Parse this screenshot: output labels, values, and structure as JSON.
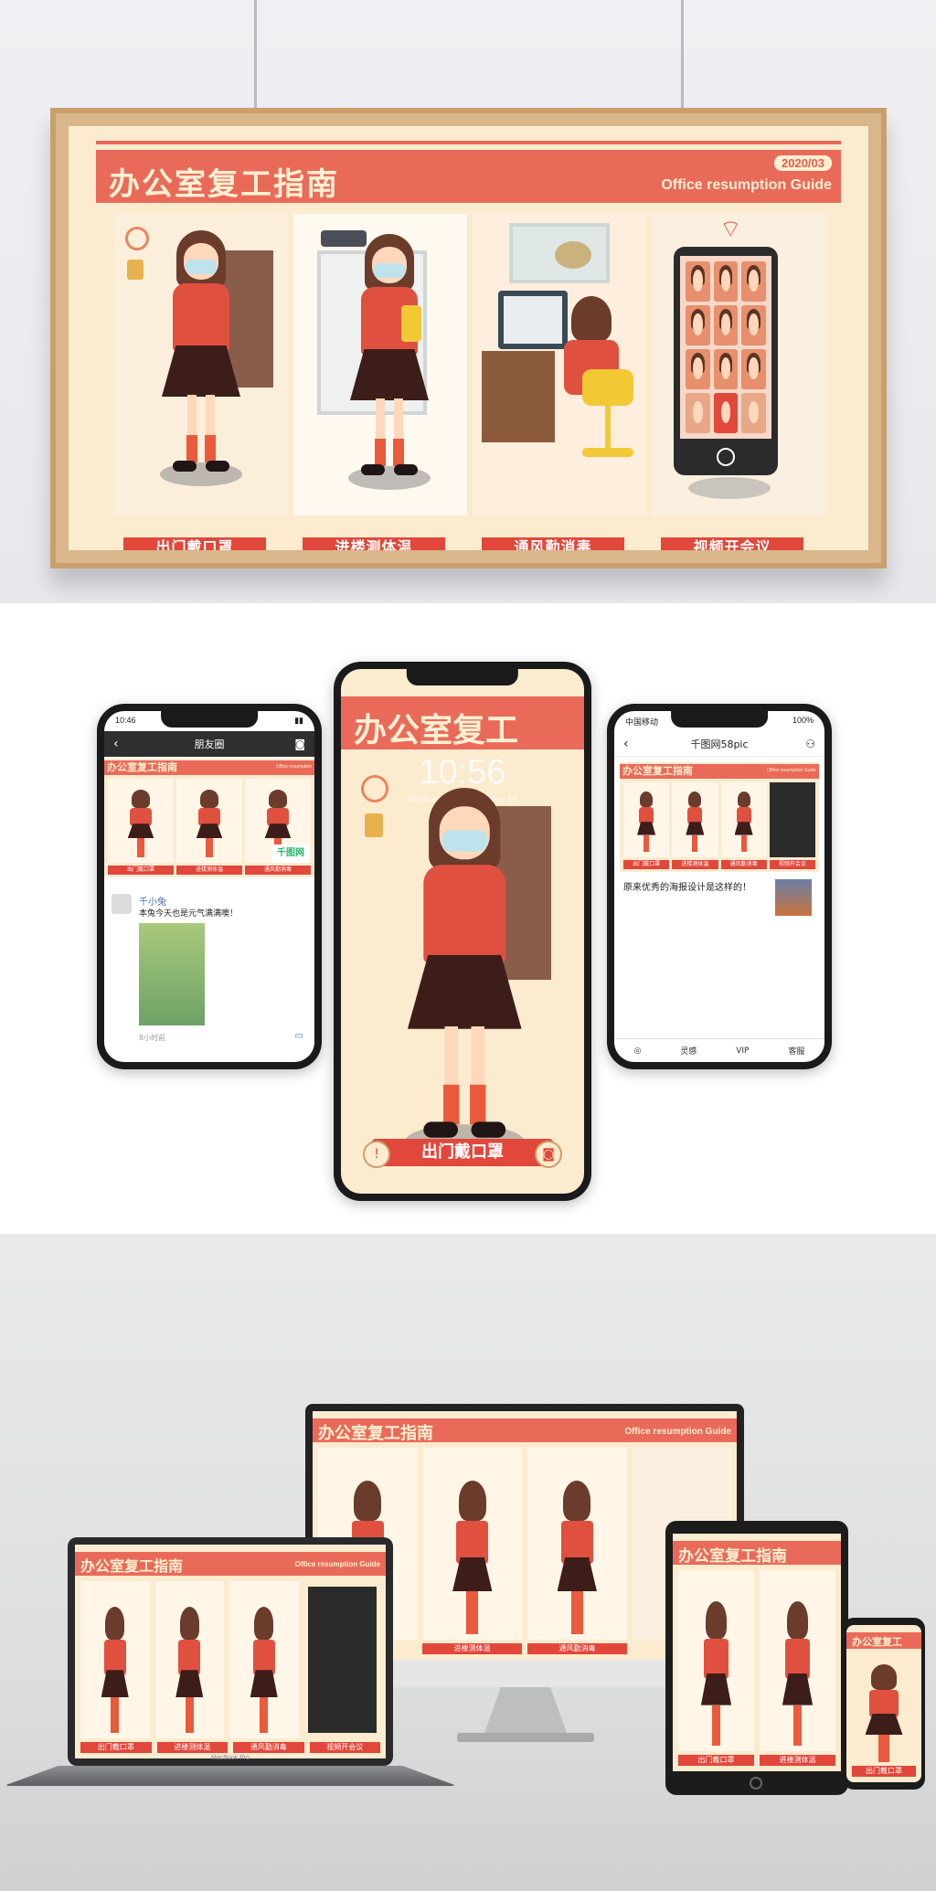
{
  "poster": {
    "title": "办公室复工指南",
    "subtitle": "Office resumption Guide",
    "date": "2020/03",
    "labels": [
      "出门戴口罩",
      "进楼测体温",
      "通风勤消毒",
      "视频开会议"
    ]
  },
  "phone_left": {
    "time": "10:46",
    "nav_title": "朋友圈",
    "watermark": "千图网",
    "post_name": "千小兔",
    "post_text": "本兔今天也是元气满满噢！",
    "post_time": "8小时前",
    "mini_title": "办公室复工指南",
    "mini_sub": "Office resumption",
    "mini_labels": [
      "出门戴口罩",
      "进楼测体温",
      "通风勤消毒"
    ]
  },
  "phone_center": {
    "title": "办公室复工",
    "lock_time": "10:56",
    "lock_date": "Wednesday, September 16",
    "label": "出门戴口罩",
    "left_icon": "!",
    "right_icon": "◙"
  },
  "phone_right": {
    "carrier": "中国移动",
    "battery": "100%",
    "nav_title": "千图网58pic",
    "mini_title": "办公室复工指南",
    "mini_sub": "Office resumption Guide",
    "mini_labels": [
      "出门戴口罩",
      "进楼测体温",
      "通风勤消毒",
      "视频开会议"
    ],
    "article_text": "原来优秀的海报设计是这样的！",
    "tabs": [
      "灵感",
      "VIP",
      "客服"
    ]
  },
  "devices": {
    "monitor_title": "办公室复工指南",
    "monitor_sub": "Office resumption Guide",
    "monitor_labels": [
      "进楼测体温",
      "通风勤消毒"
    ],
    "laptop_title": "办公室复工指南",
    "laptop_sub": "Office resumption Guide",
    "laptop_labels": [
      "出门戴口罩",
      "进楼测体温",
      "通风勤消毒",
      "视频开会议"
    ],
    "laptop_brand": "MacBook Pro",
    "tablet_title": "办公室复工指南",
    "tablet_labels": [
      "出门戴口罩",
      "进楼测体温"
    ],
    "small_phone_title": "办公室复工",
    "small_phone_label": "出门戴口罩"
  },
  "colors": {
    "accent": "#e2473b",
    "title_bar": "#ea6a5a",
    "cream": "#fbebcf"
  }
}
